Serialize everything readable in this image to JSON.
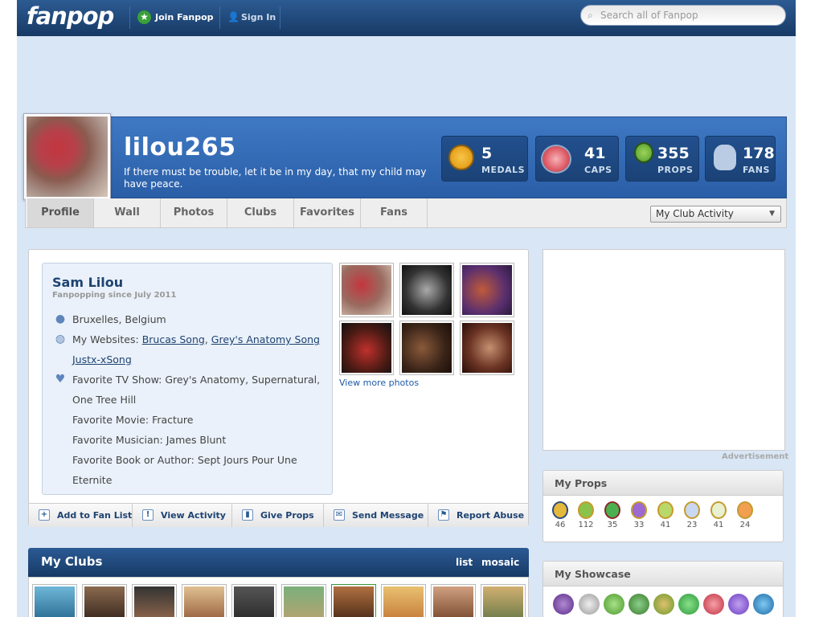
{
  "topbar": {
    "logo": "fanpop",
    "join_label": "Join Fanpop",
    "signin_label": "Sign In",
    "search_placeholder": "Search all of Fanpop"
  },
  "profile": {
    "username": "lilou265",
    "tagline": "If there must be trouble, let it be in my day, that my child may have peace."
  },
  "stats": [
    {
      "value": "5",
      "label": "MEDALS",
      "icon": "medal-icon",
      "color": "#f2b12b"
    },
    {
      "value": "41",
      "label": "CAPS",
      "icon": "caps-icon",
      "color": "#e0606b"
    },
    {
      "value": "355",
      "label": "PROPS",
      "icon": "ribbon-icon",
      "color": "#6db33f"
    },
    {
      "value": "178",
      "label": "FANS",
      "icon": "fans-icon",
      "color": "#b9cce4"
    }
  ],
  "tabs": [
    "Profile",
    "Wall",
    "Photos",
    "Clubs",
    "Favorites",
    "Fans"
  ],
  "activity_select": "My Club Activity",
  "info": {
    "name": "Sam Lilou",
    "since": "Fanpopping since July 2011",
    "location": "Bruxelles, Belgium",
    "websites_label": "My Websites:",
    "website_1": "Brucas Song",
    "website_2": "Grey's Anatomy Song",
    "website_3": "Justx-xSong",
    "tv_line1": "Favorite TV Show: Grey's Anatomy, Supernatural,",
    "tv_line2": "One Tree Hill",
    "movie": "Favorite Movie: Fracture",
    "musician": "Favorite Musician: James Blunt",
    "book_line1": "Favorite Book or Author: Sept Jours Pour Une",
    "book_line2": "Eternite"
  },
  "view_more": "View more photos",
  "actions": [
    "Add to Fan List",
    "View Activity",
    "Give Props",
    "Send Message",
    "Report Abuse"
  ],
  "clubs": {
    "title": "My Clubs",
    "view_list": "list",
    "view_mosaic": "mosaic"
  },
  "ad_label": "Advertisement",
  "props": {
    "title": "My Props",
    "counts": [
      "46",
      "112",
      "35",
      "33",
      "41",
      "23",
      "41",
      "24"
    ]
  },
  "showcase": {
    "title": "My Showcase"
  },
  "colors": {
    "topbar": "#1f4a80",
    "header": "#3670ba",
    "page_bg": "#d8e6f5",
    "link": "#1e4372"
  }
}
